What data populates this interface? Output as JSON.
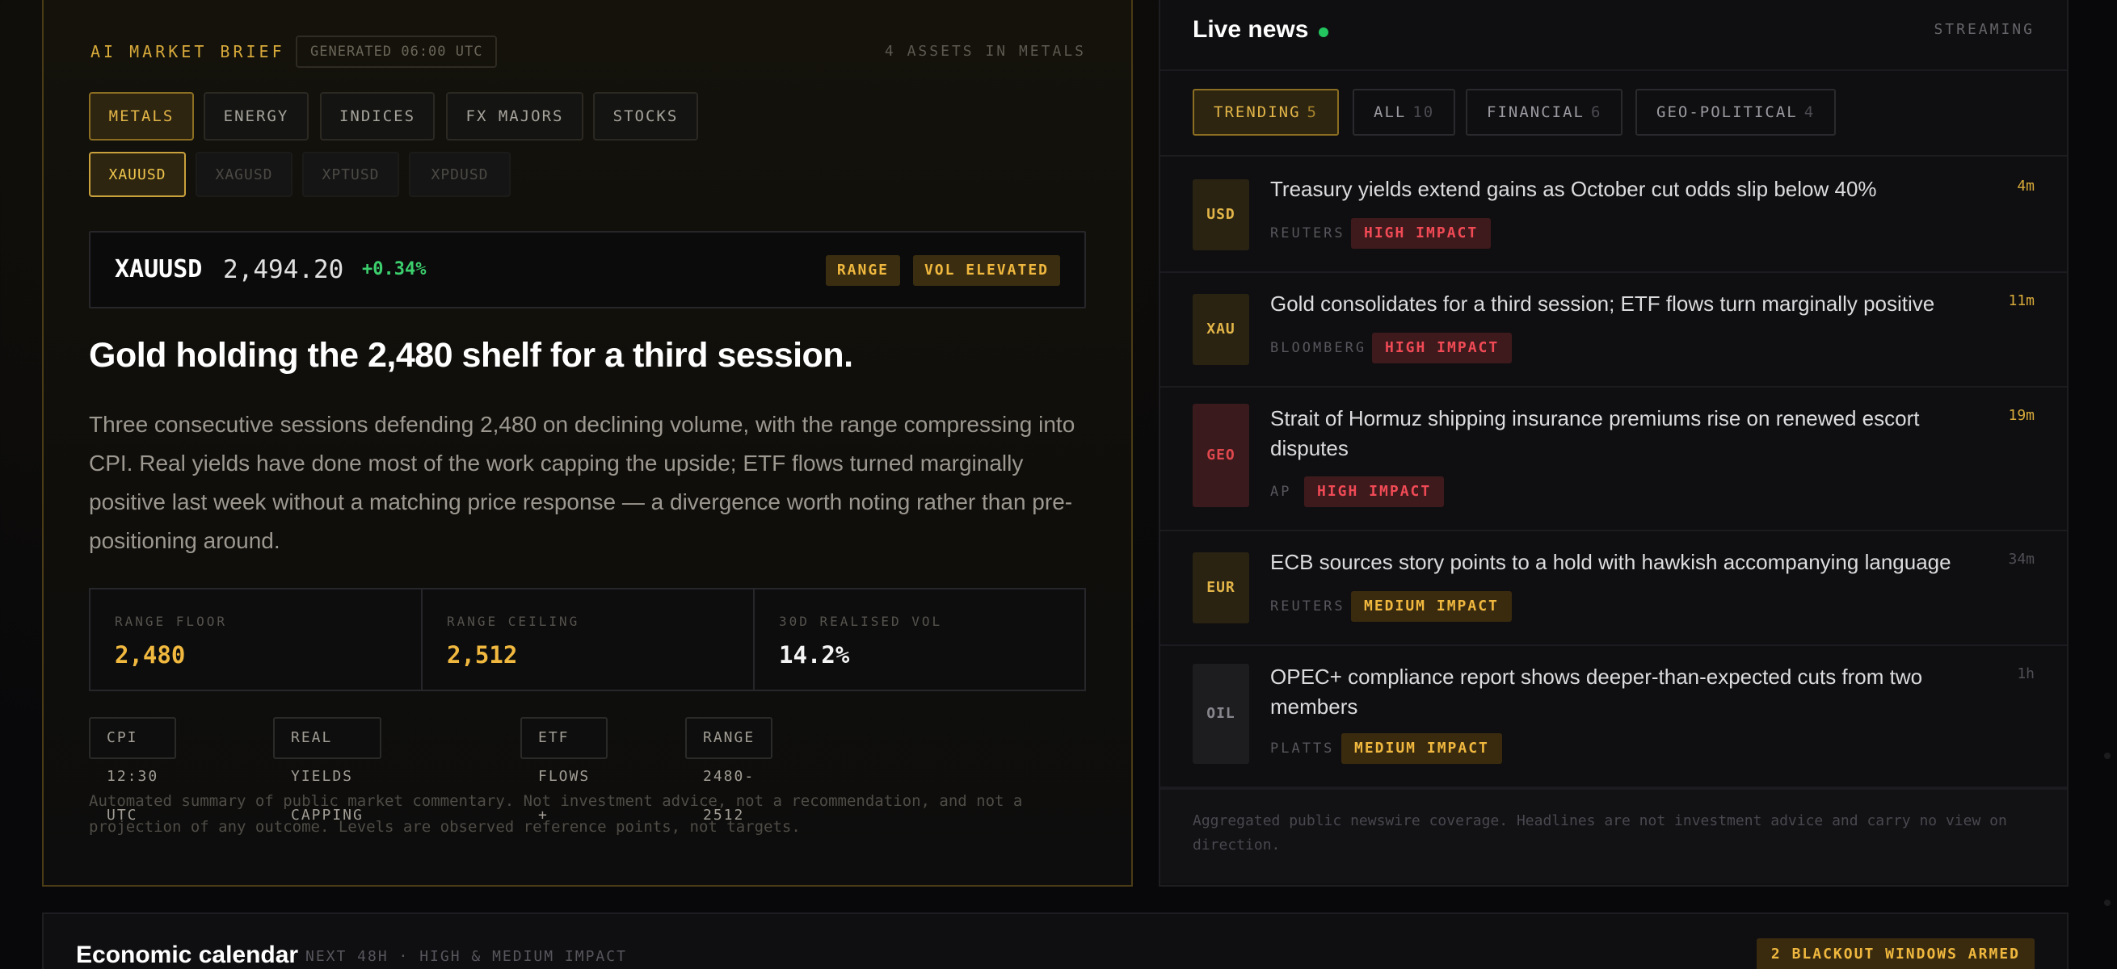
{
  "brief": {
    "title": "AI MARKET BRIEF",
    "generated": "GENERATED 06:00 UTC",
    "asset_count": "4 ASSETS IN METALS",
    "categories": [
      "METALS",
      "ENERGY",
      "INDICES",
      "FX MAJORS",
      "STOCKS"
    ],
    "active_category": "METALS",
    "symbols": [
      "XAUUSD",
      "XAGUSD",
      "XPTUSD",
      "XPDUSD"
    ],
    "active_symbol": "XAUUSD",
    "quote": {
      "symbol": "XAUUSD",
      "price": "2,494.20",
      "change": "+0.34%",
      "badges": [
        "RANGE",
        "VOL ELEVATED"
      ]
    },
    "headline": "Gold holding the 2,480 shelf for a third session.",
    "summary": "Three consecutive sessions defending 2,480 on declining volume, with the range compressing into CPI. Real yields have done most of the work capping the upside; ETF flows turned marginally positive last week without a matching price response — a divergence worth noting rather than pre-positioning around.",
    "stats": [
      {
        "label": "RANGE FLOOR",
        "value": "2,480"
      },
      {
        "label": "RANGE CEILING",
        "value": "2,512"
      },
      {
        "label": "30D REALISED VOL",
        "value": "14.2%"
      }
    ],
    "tags": [
      "CPI 12:30 UTC",
      "REAL YIELDS CAPPING",
      "ETF FLOWS +",
      "RANGE 2480-2512"
    ],
    "disclaimer": "Automated summary of public market commentary. Not investment advice, not a recommendation, and not a projection of any outcome. Levels are observed reference points, not targets."
  },
  "news": {
    "title": "Live news",
    "status": "STREAMING",
    "filters": [
      {
        "label": "TRENDING",
        "count": "5"
      },
      {
        "label": "ALL",
        "count": "10"
      },
      {
        "label": "FINANCIAL",
        "count": "6"
      },
      {
        "label": "GEO-POLITICAL",
        "count": "4"
      }
    ],
    "items": [
      {
        "tag": "USD",
        "headline": "Treasury yields extend gains as October cut odds slip below 40%",
        "source": "REUTERS",
        "impact": "HIGH IMPACT",
        "time": "4m"
      },
      {
        "tag": "XAU",
        "headline": "Gold consolidates for a third session; ETF flows turn marginally positive",
        "source": "BLOOMBERG",
        "impact": "HIGH IMPACT",
        "time": "11m"
      },
      {
        "tag": "GEO",
        "headline": "Strait of Hormuz shipping insurance premiums rise on renewed escort disputes",
        "source": "AP",
        "impact": "HIGH IMPACT",
        "time": "19m"
      },
      {
        "tag": "EUR",
        "headline": "ECB sources story points to a hold with hawkish accompanying language",
        "source": "REUTERS",
        "impact": "MEDIUM IMPACT",
        "time": "34m"
      },
      {
        "tag": "OIL",
        "headline": "OPEC+ compliance report shows deeper-than-expected cuts from two members",
        "source": "PLATTS",
        "impact": "MEDIUM IMPACT",
        "time": "1h"
      }
    ],
    "footer": "Aggregated public newswire coverage. Headlines are not investment advice and carry no view on direction."
  },
  "calendar": {
    "title": "Economic calendar",
    "subtitle": "NEXT 48H · HIGH & MEDIUM IMPACT",
    "badge": "2 BLACKOUT WINDOWS ARMED"
  },
  "colors": {
    "accent": "#e3b548",
    "positive": "#3ccf6d",
    "high_impact": "#f04a55",
    "live": "#22c55e"
  }
}
